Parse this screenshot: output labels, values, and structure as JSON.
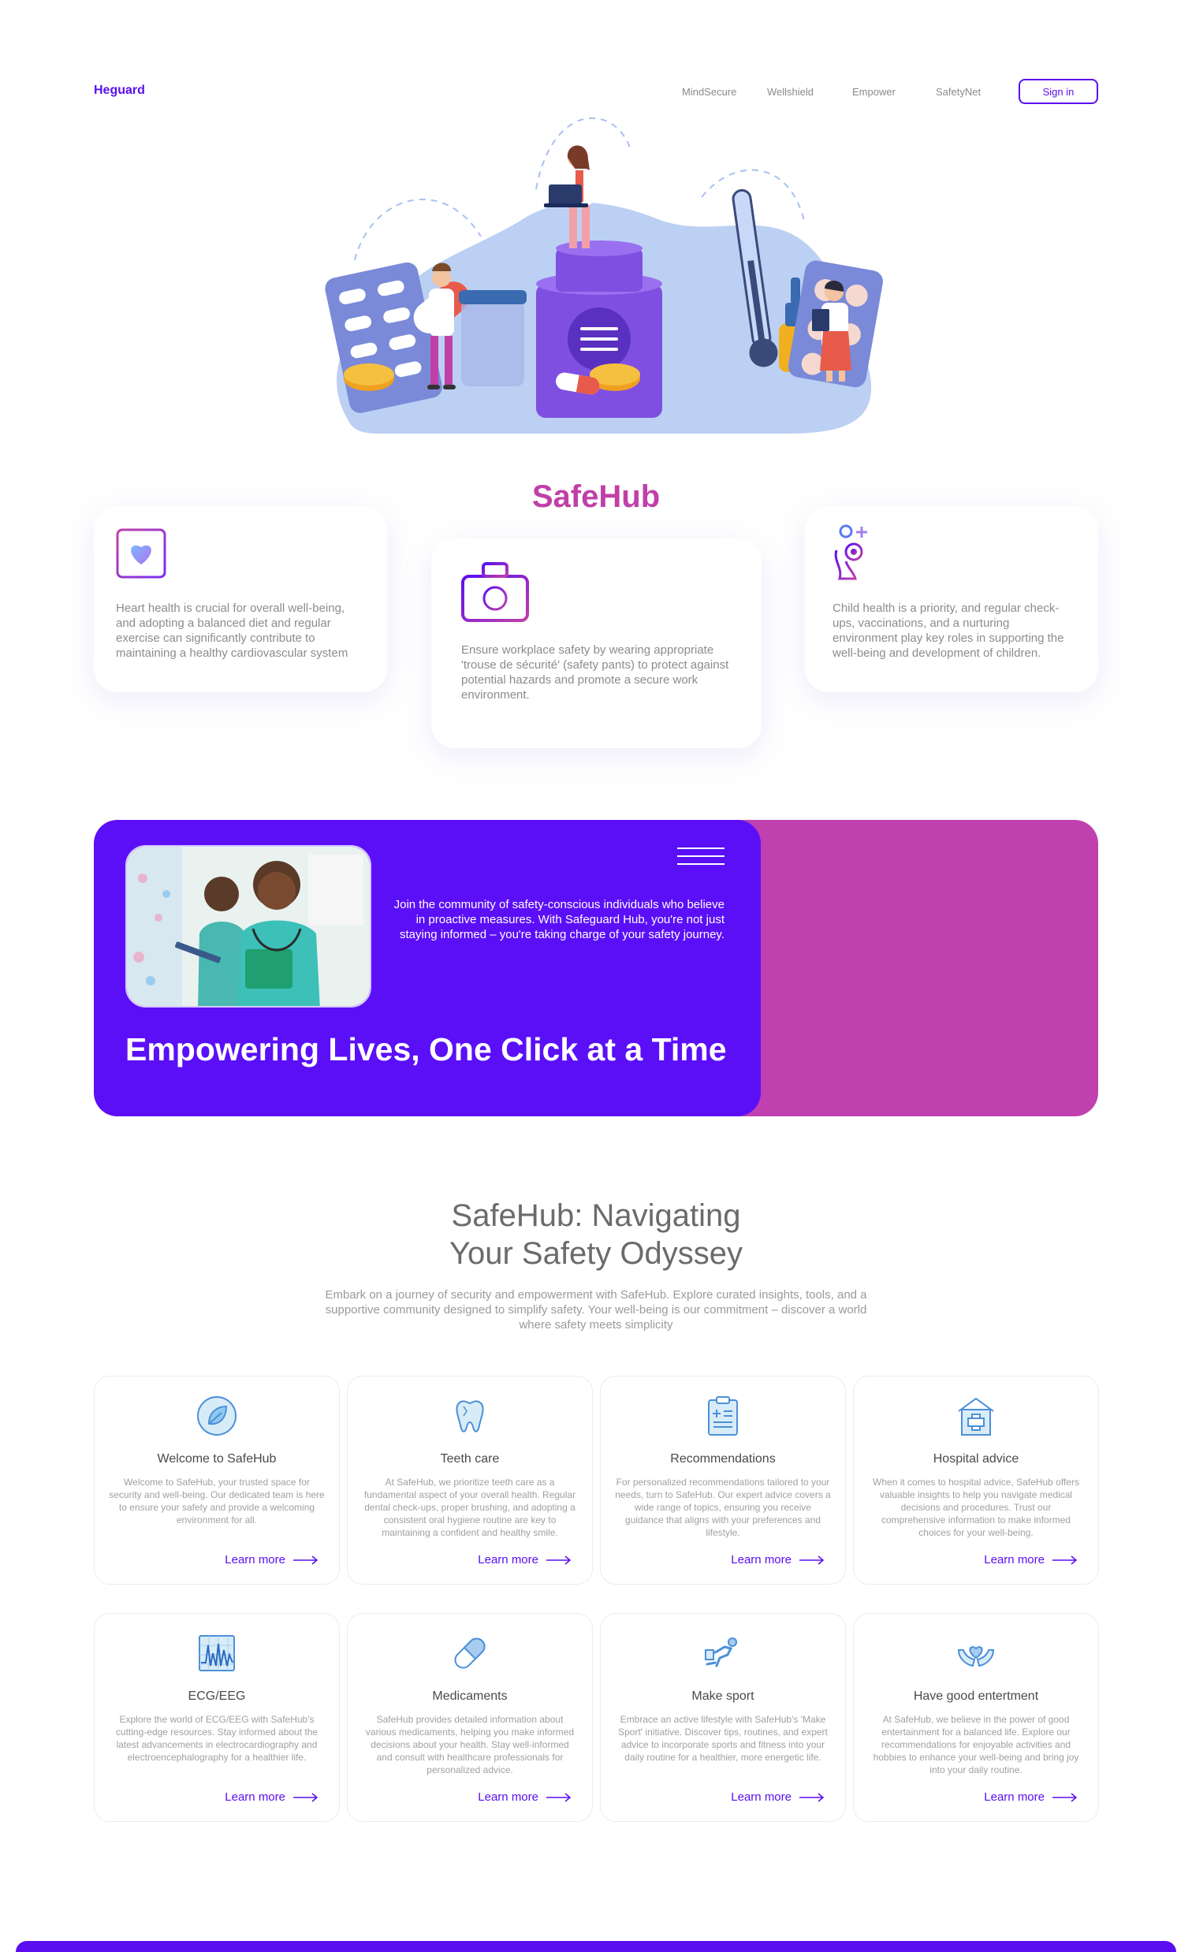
{
  "header": {
    "logo": "Heguard",
    "nav": [
      "MindSecure",
      "Wellshield",
      "Empower",
      "SafetyNet"
    ],
    "signin_label": "Sign in"
  },
  "hero": {
    "title": "SafeHub"
  },
  "features": [
    {
      "icon": "heart-icon",
      "text": "Heart health is crucial for overall well-being, and adopting a balanced diet and regular exercise can significantly contribute to maintaining a healthy cardiovascular system"
    },
    {
      "icon": "first-aid-kit-icon",
      "text": "Ensure workplace safety by wearing appropriate 'trouse de sécurité' (safety pants) to protect against potential hazards and promote a secure work environment."
    },
    {
      "icon": "child-health-icon",
      "text": "Child health is a priority, and regular check-ups, vaccinations, and a nurturing environment play key roles in supporting the well-being and development of children."
    }
  ],
  "banner": {
    "text": "Join the community of safety-conscious individuals who believe in proactive measures. With Safeguard Hub, you're not just staying informed – you're taking charge of your safety journey.",
    "title": "Empowering Lives, One Click at a Time"
  },
  "section": {
    "title_line1": "SafeHub: Navigating",
    "title_line2": "Your Safety Odyssey",
    "subtitle": "Embark on a journey of security and empowerment with SafeHub. Explore curated insights, tools, and a supportive community designed to simplify safety. Your well-being is our commitment – discover a world where safety meets simplicity"
  },
  "services": [
    {
      "icon": "leaf-icon",
      "title": "Welcome to SafeHub",
      "desc": "Welcome to SafeHub, your trusted space for security and well-being. Our dedicated team is here to ensure your safety and provide a welcoming environment for all.",
      "link": "Learn more"
    },
    {
      "icon": "tooth-icon",
      "title": "Teeth care",
      "desc": "At SafeHub, we prioritize teeth care as a fundamental aspect of your overall health. Regular dental check-ups, proper brushing, and adopting a consistent oral hygiene routine are key to maintaining a confident and healthy smile.",
      "link": "Learn more"
    },
    {
      "icon": "clipboard-icon",
      "title": "Recommendations",
      "desc": "For personalized recommendations tailored to your needs, turn to SafeHub. Our expert advice covers a wide range of topics, ensuring you receive guidance that aligns with your preferences and lifestyle.",
      "link": "Learn more"
    },
    {
      "icon": "hospital-icon",
      "title": "Hospital advice",
      "desc": "When it comes to hospital advice, SafeHub offers valuable insights to help you navigate medical decisions and procedures. Trust our comprehensive information to make informed choices for your well-being.",
      "link": "Learn more"
    },
    {
      "icon": "ecg-icon",
      "title": "ECG/EEG",
      "desc": "Explore the world of ECG/EEG with SafeHub's cutting-edge resources. Stay informed about the latest advancements in electrocardiography and electroencephalography for a healthier life.",
      "link": "Learn more"
    },
    {
      "icon": "pill-icon",
      "title": "Medicaments",
      "desc": "SafeHub provides detailed information about various medicaments, helping you make informed decisions about your health. Stay well-informed and consult with healthcare professionals for personalized advice.",
      "link": "Learn more"
    },
    {
      "icon": "sport-icon",
      "title": "Make sport",
      "desc": "Embrace an active lifestyle with SafeHub's 'Make Sport' initiative. Discover tips, routines, and expert advice to incorporate sports and fitness into your daily routine for a healthier, more energetic life.",
      "link": "Learn more"
    },
    {
      "icon": "hands-heart-icon",
      "title": "Have good entertment",
      "desc": "At SafeHub, we believe in the power of good entertainment for a balanced life. Explore our recommendations for enjoyable activities and hobbies to enhance your well-being and bring joy into your daily routine.",
      "link": "Learn more"
    }
  ],
  "colors": {
    "primary": "#5b0ff0",
    "accent": "#c040a8"
  }
}
